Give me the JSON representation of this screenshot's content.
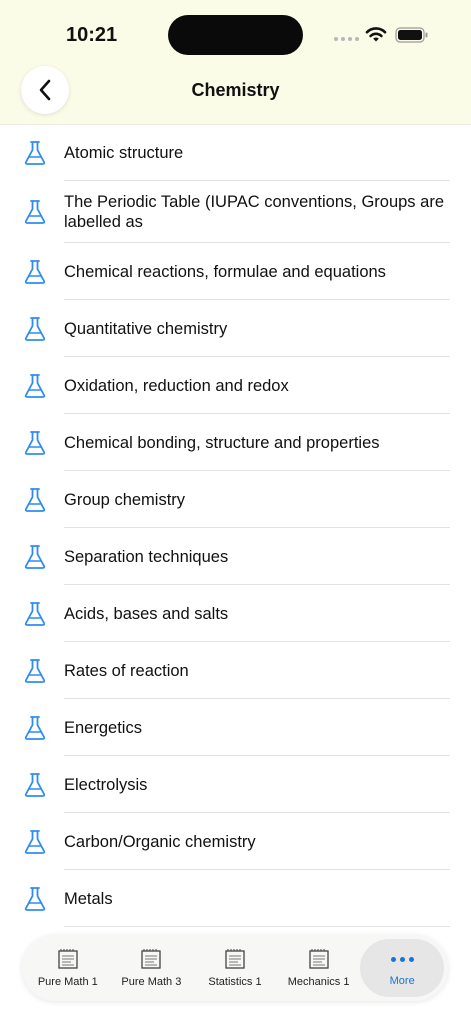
{
  "status_bar": {
    "time": "10:21"
  },
  "header": {
    "title": "Chemistry"
  },
  "topics": [
    "Atomic structure",
    "The Periodic Table (IUPAC conventions, Groups are labelled as",
    "Chemical reactions, formulae and equations",
    "Quantitative chemistry",
    "Oxidation, reduction and redox",
    "Chemical bonding, structure and properties",
    "Group chemistry",
    "Separation techniques",
    "Acids, bases and salts",
    "Rates of reaction",
    "Energetics",
    "Electrolysis",
    "Carbon/Organic chemistry",
    "Metals"
  ],
  "tabbar": {
    "tabs": [
      "Pure Math 1",
      "Pure Math 3",
      "Statistics 1",
      "Mechanics 1",
      "More"
    ],
    "active": "More"
  },
  "colors": {
    "accent": "#1a73d9",
    "header_bg": "#fbfce8",
    "icon": "#2e8cf0"
  },
  "icons": {
    "topic": "flask-icon",
    "back": "chevron-left-icon",
    "tab": "notebook-icon",
    "more": "ellipsis-icon"
  }
}
